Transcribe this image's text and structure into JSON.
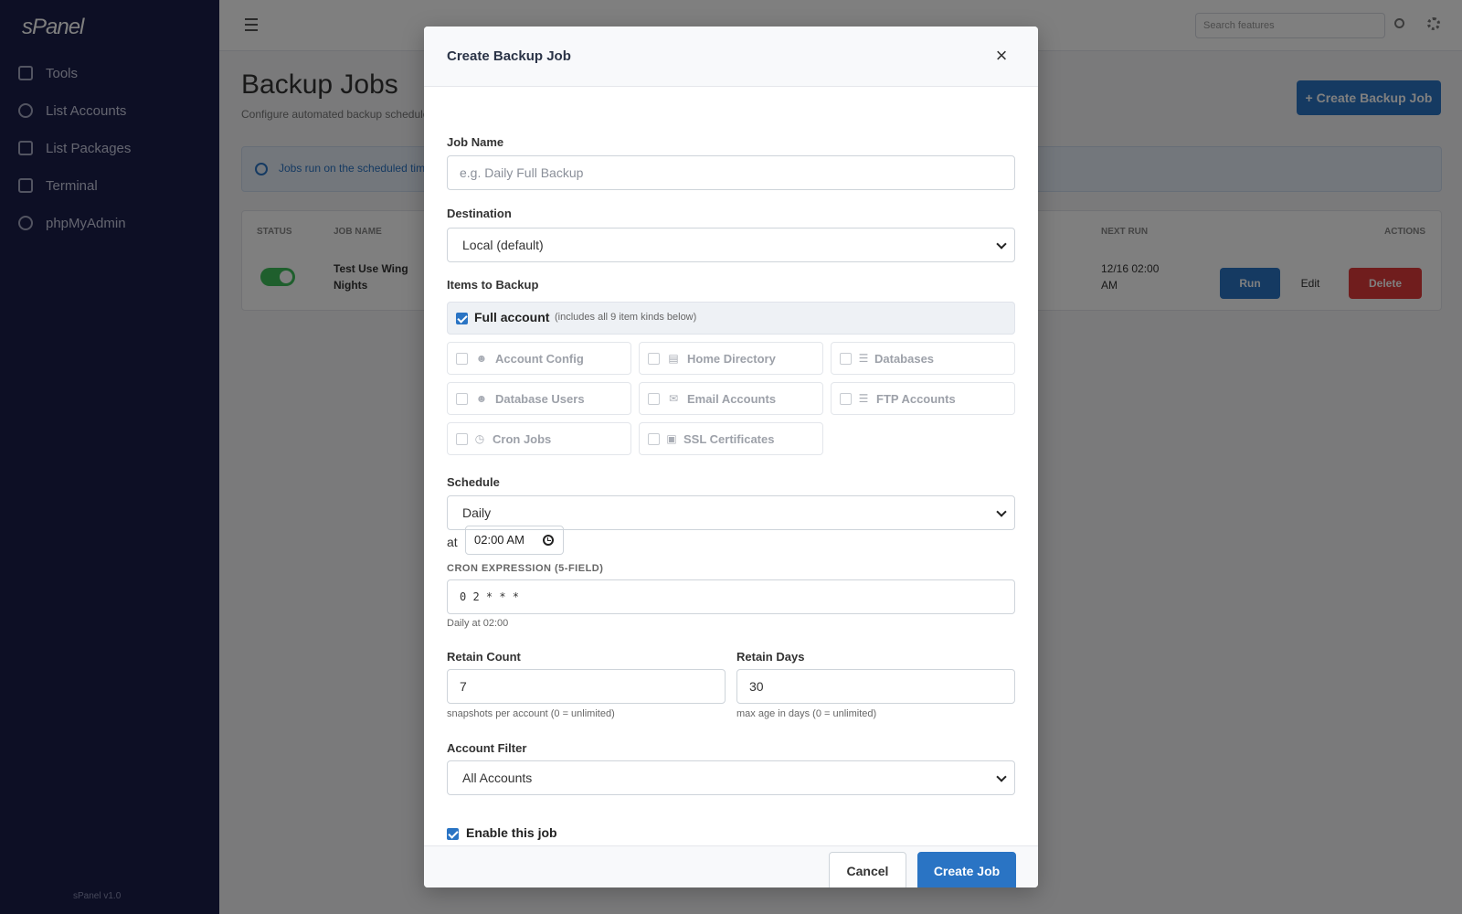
{
  "sidebar": {
    "logo": "sPanel",
    "items": [
      {
        "label": "Tools",
        "icon": "wrench-icon"
      },
      {
        "label": "List Accounts",
        "icon": "users-icon"
      },
      {
        "label": "List Packages",
        "icon": "package-icon"
      },
      {
        "label": "Terminal",
        "icon": "terminal-icon"
      },
      {
        "label": "phpMyAdmin",
        "icon": "database-icon"
      }
    ],
    "footer": "sPanel v1.0"
  },
  "topbar": {
    "search_placeholder": "Search features"
  },
  "page": {
    "title": "Backup Jobs",
    "subtitle": "Configure automated backup schedules",
    "create_button": "+ Create Backup Job",
    "info_text": "Jobs run on the scheduled time",
    "table_headers": [
      "Status",
      "Job Name",
      "Next Run",
      "Actions"
    ],
    "rows": [
      {
        "name": "Test Use Wing Nights",
        "next_run": "12/16 02:00 AM",
        "run_label": "Run",
        "edit_label": "Edit",
        "delete_label": "Delete"
      }
    ]
  },
  "modal": {
    "title": "Create Backup Job",
    "close_label": "×",
    "job_name": {
      "label": "Job Name",
      "placeholder": "e.g. Daily Full Backup",
      "value": ""
    },
    "destination": {
      "label": "Destination",
      "value": "Local (default)"
    },
    "items": {
      "label": "Items to Backup",
      "full_account_label": "Full account",
      "full_account_hint": "(includes all 9 item kinds below)",
      "full_account_checked": true,
      "list": [
        {
          "label": "Account Config",
          "icon": "user-gear-icon"
        },
        {
          "label": "Home Directory",
          "icon": "folder-icon"
        },
        {
          "label": "Databases",
          "icon": "database-icon"
        },
        {
          "label": "Database Users",
          "icon": "user-gear-icon"
        },
        {
          "label": "Email Accounts",
          "icon": "envelope-icon"
        },
        {
          "label": "FTP Accounts",
          "icon": "server-icon"
        },
        {
          "label": "Cron Jobs",
          "icon": "clock-icon"
        },
        {
          "label": "SSL Certificates",
          "icon": "lock-icon"
        }
      ]
    },
    "schedule": {
      "label": "Schedule",
      "value": "Daily",
      "at_label": "at",
      "time": "02:00 AM",
      "cron_label": "CRON EXPRESSION (5-FIELD)",
      "cron_value": "0 2 * * *",
      "cron_help": "Daily at 02:00"
    },
    "retain_count": {
      "label": "Retain Count",
      "value": "7",
      "help": "snapshots per account (0 = unlimited)"
    },
    "retain_days": {
      "label": "Retain Days",
      "value": "30",
      "help": "max age in days (0 = unlimited)"
    },
    "account_filter": {
      "label": "Account Filter",
      "value": "All Accounts"
    },
    "enable": {
      "label": "Enable this job",
      "checked": true
    },
    "cancel_label": "Cancel",
    "create_label": "Create Job"
  },
  "colors": {
    "sidebar_bg": "#1b1f4a",
    "primary": "#2a74c4",
    "danger": "#e03b3b",
    "success": "#3fbf5a"
  }
}
